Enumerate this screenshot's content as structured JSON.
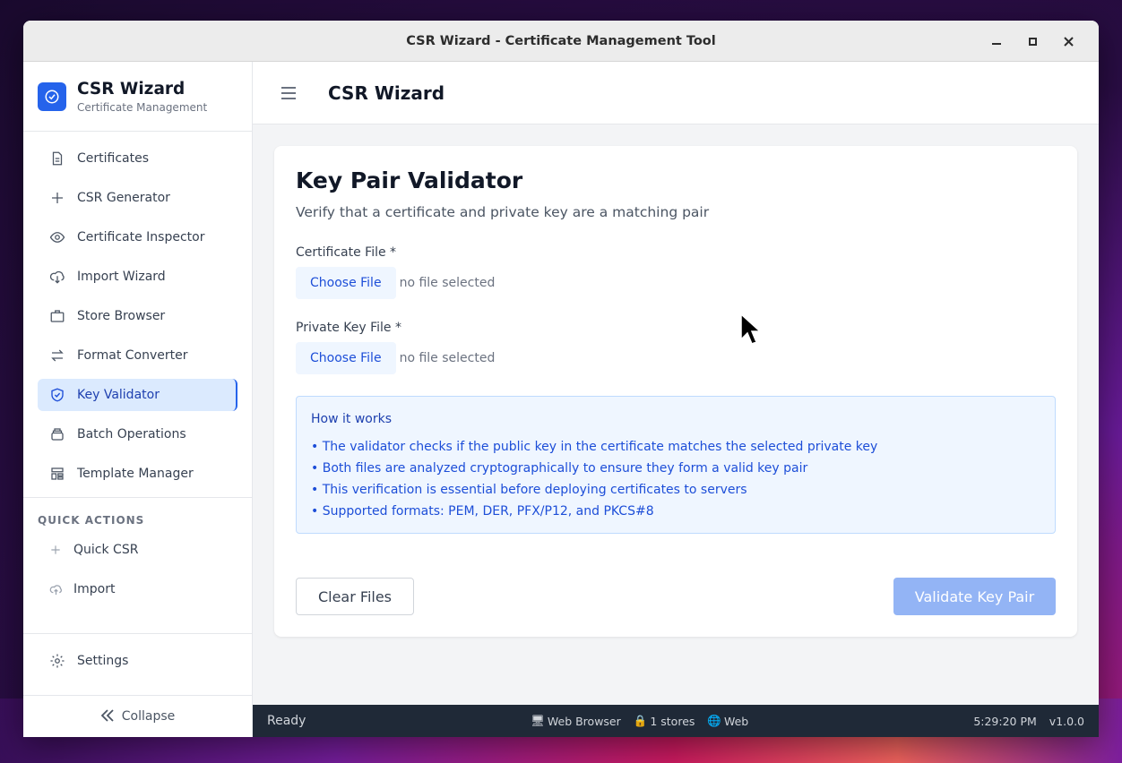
{
  "window": {
    "title": "CSR Wizard - Certificate Management Tool"
  },
  "brand": {
    "title": "CSR Wizard",
    "subtitle": "Certificate Management"
  },
  "sidebar": {
    "items": [
      {
        "label": "Certificates",
        "icon": "document-icon"
      },
      {
        "label": "CSR Generator",
        "icon": "plus-icon"
      },
      {
        "label": "Certificate Inspector",
        "icon": "eye-icon"
      },
      {
        "label": "Import Wizard",
        "icon": "cloud-download-icon"
      },
      {
        "label": "Store Browser",
        "icon": "briefcase-icon"
      },
      {
        "label": "Format Converter",
        "icon": "arrows-swap-icon"
      },
      {
        "label": "Key Validator",
        "icon": "shield-check-icon",
        "active": true
      },
      {
        "label": "Batch Operations",
        "icon": "stack-icon"
      },
      {
        "label": "Template Manager",
        "icon": "template-icon"
      }
    ],
    "quick_actions_heading": "QUICK ACTIONS",
    "quick_actions": [
      {
        "label": "Quick CSR",
        "icon": "plus-icon"
      },
      {
        "label": "Import",
        "icon": "cloud-upload-icon"
      }
    ],
    "settings_label": "Settings",
    "collapse_label": "Collapse"
  },
  "header": {
    "title": "CSR Wizard"
  },
  "validator": {
    "title": "Key Pair Validator",
    "subtitle": "Verify that a certificate and private key are a matching pair",
    "cert_label": "Certificate File *",
    "key_label": "Private Key File *",
    "choose_label": "Choose File",
    "no_file": "no file selected",
    "info_title": "How it works",
    "info_items": [
      "• The validator checks if the public key in the certificate matches the selected private key",
      "• Both files are analyzed cryptographically to ensure they form a valid key pair",
      "• This verification is essential before deploying certificates to servers",
      "• Supported formats: PEM, DER, PFX/P12, and PKCS#8"
    ],
    "clear_label": "Clear Files",
    "validate_label": "Validate Key Pair"
  },
  "status": {
    "state": "Ready",
    "browser": "Web Browser",
    "stores": "1 stores",
    "platform": "Web",
    "time": "5:29:20 PM",
    "version": "v1.0.0"
  },
  "colors": {
    "accent": "#2563eb",
    "active_bg": "#dbeafe",
    "status_bg": "#1f2937",
    "info_bg": "#eff6ff"
  }
}
